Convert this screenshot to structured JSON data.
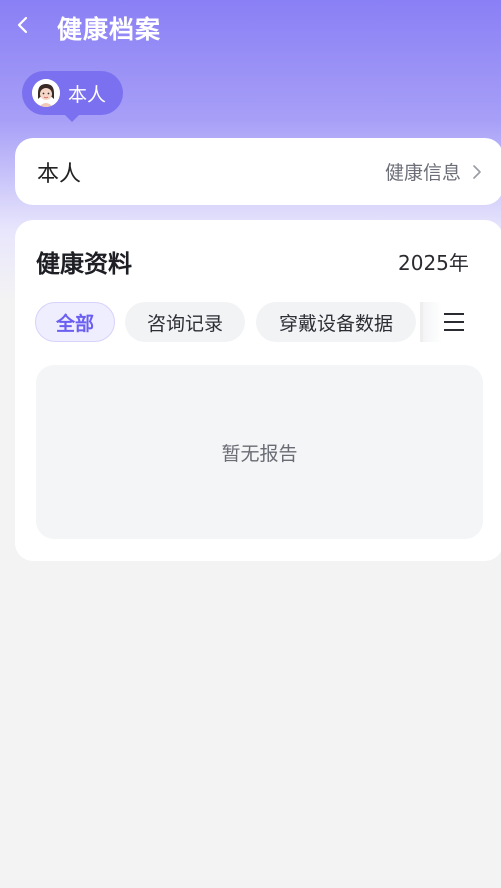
{
  "header": {
    "title": "健康档案",
    "back_icon": "chevron-left-icon"
  },
  "chip": {
    "label": "本人",
    "avatar_icon": "avatar-icon",
    "accent": "#7b70ef"
  },
  "profile": {
    "name": "本人",
    "link_label": "健康信息",
    "chevron_icon": "chevron-right-icon"
  },
  "section": {
    "title": "健康资料",
    "year": "2025年"
  },
  "tabs": [
    {
      "label": "全部",
      "active": true
    },
    {
      "label": "咨询记录",
      "active": false
    },
    {
      "label": "穿戴设备数据",
      "active": false
    }
  ],
  "menu_icon": "menu-icon",
  "empty": {
    "text": "暂无报告"
  },
  "colors": {
    "gradient_top": "#8a7ff5",
    "active_tab_text": "#6b5ff2",
    "background": "#f3f3f4"
  }
}
